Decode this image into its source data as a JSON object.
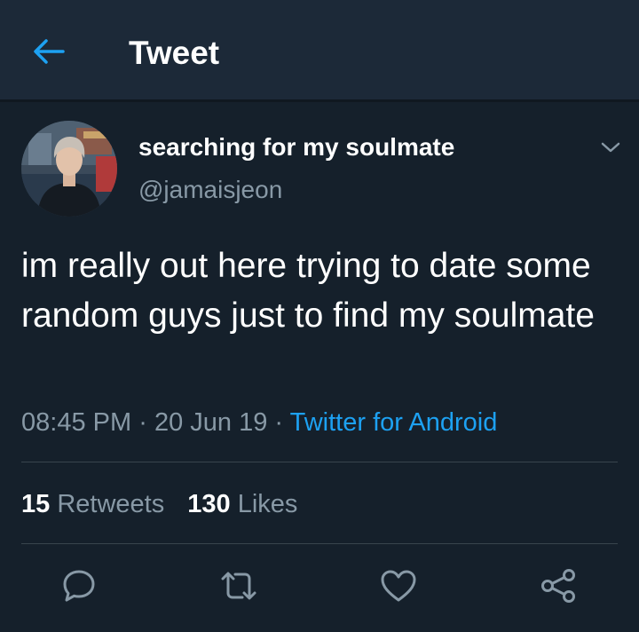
{
  "header": {
    "back_icon": "arrow-left-icon",
    "title": "Tweet",
    "accent_color": "#1da1f2"
  },
  "tweet": {
    "display_name": "searching for my soulmate",
    "handle": "@jamaisjeon",
    "text": "im really out here trying to date some random guys just to find my soulmate",
    "time": "08:45 PM",
    "date": "20 Jun 19",
    "separator": "·",
    "source": "Twitter for Android",
    "caret_icon": "chevron-down-icon"
  },
  "stats": {
    "retweets_count": "15",
    "retweets_label": "Retweets",
    "likes_count": "130",
    "likes_label": "Likes"
  },
  "actions": {
    "reply_icon": "reply-icon",
    "retweet_icon": "retweet-icon",
    "like_icon": "heart-icon",
    "share_icon": "share-icon"
  },
  "colors": {
    "background": "#15202b",
    "header_background": "#1c2938",
    "secondary_text": "#8899a6",
    "link": "#1da1f2"
  }
}
